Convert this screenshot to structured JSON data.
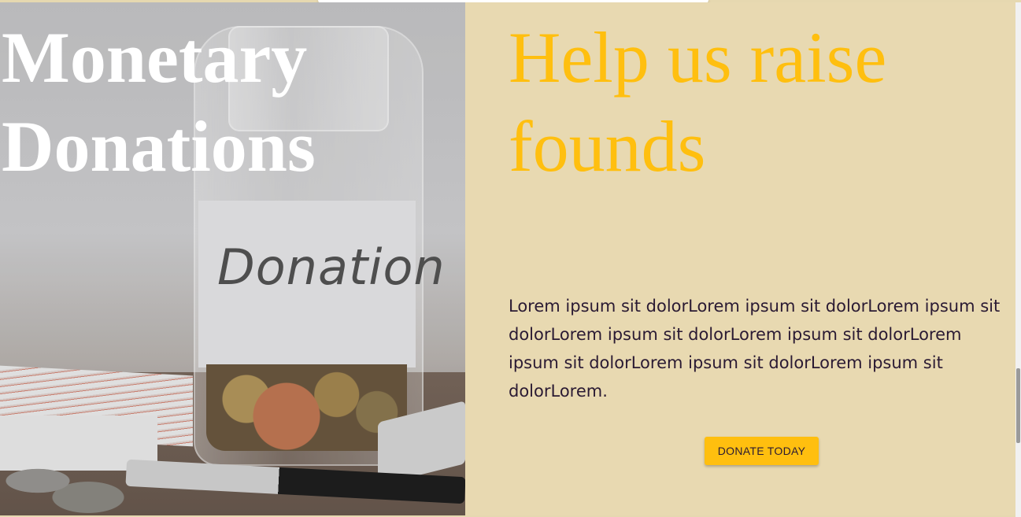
{
  "left": {
    "title_line1": "Monetary",
    "title_line2": "Donations",
    "image_label_text": "Donation"
  },
  "right": {
    "title_line1": "Help us raise",
    "title_line2": "founds",
    "body": "Lorem ipsum sit dolorLorem ipsum sit dolorLorem ipsum sit dolorLorem ipsum sit dolorLorem ipsum sit dolorLorem ipsum sit dolorLorem ipsum sit dolorLorem ipsum sit dolorLorem.",
    "button_label": "DONATE TODAY"
  },
  "colors": {
    "accent": "#ffbf0f",
    "panel_background": "#e8d9b1",
    "body_text": "#2a1a33"
  }
}
